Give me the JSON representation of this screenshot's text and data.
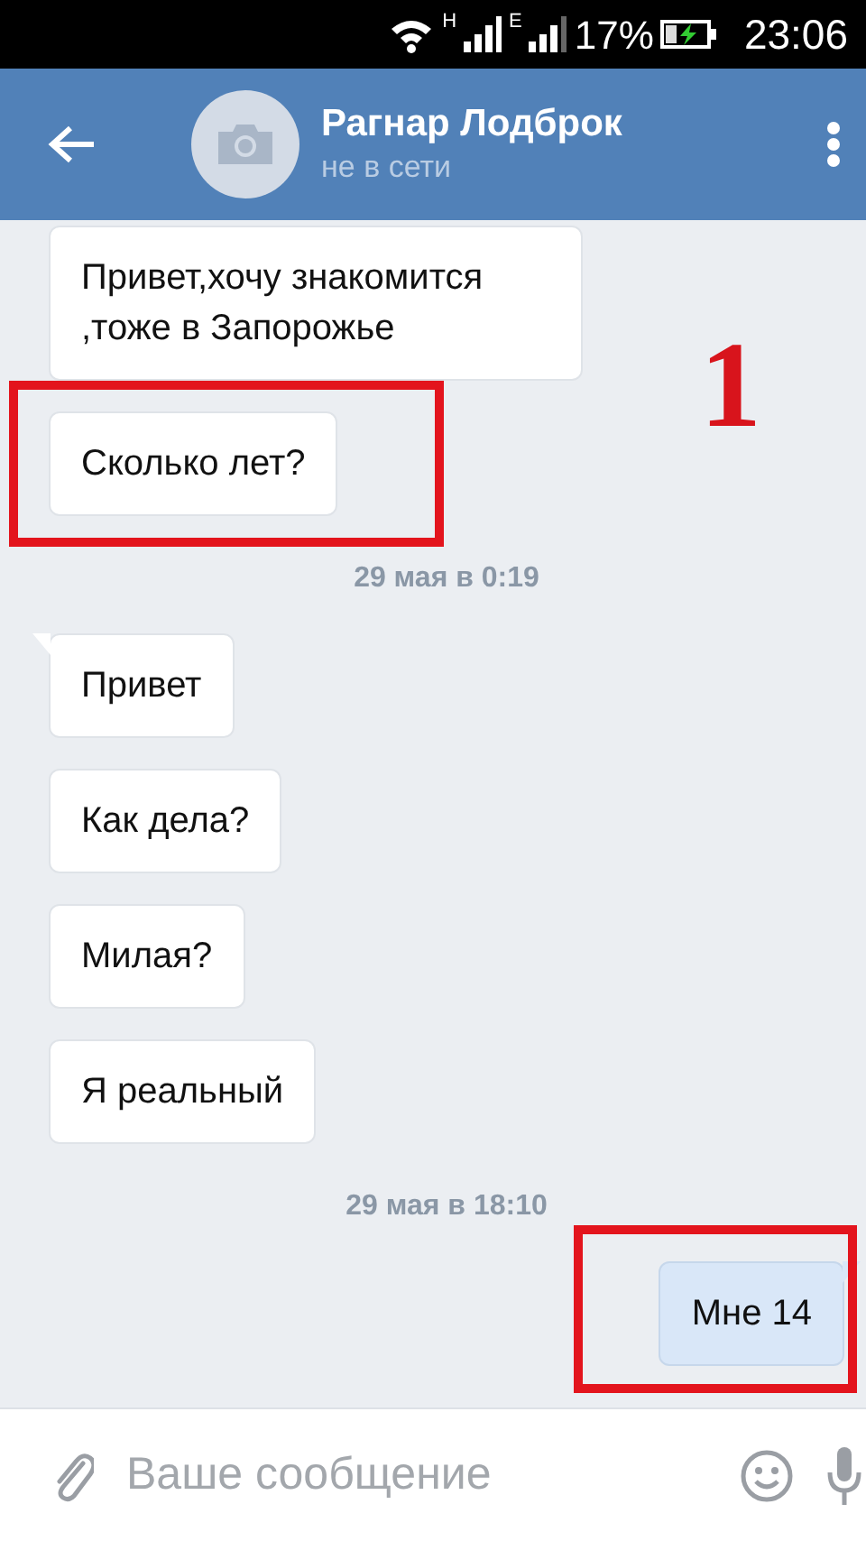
{
  "status_bar": {
    "network_1": "H",
    "network_2": "E",
    "battery": "17%",
    "battery_charging": true,
    "time": "23:06"
  },
  "header": {
    "name": "Рагнар Лодброк",
    "status": "не в сети"
  },
  "messages": [
    {
      "kind": "incoming",
      "text": "Привет,хочу знакомится ,тоже в Запорожье",
      "tail": false,
      "highlighted": false
    },
    {
      "kind": "incoming",
      "text": "Сколько лет?",
      "tail": false,
      "highlighted": true
    },
    {
      "kind": "date",
      "text": "29 мая в 0:19"
    },
    {
      "kind": "incoming",
      "text": "Привет",
      "tail": true,
      "highlighted": false
    },
    {
      "kind": "incoming",
      "text": "Как дела?",
      "tail": false,
      "highlighted": false
    },
    {
      "kind": "incoming",
      "text": "Милая?",
      "tail": false,
      "highlighted": false
    },
    {
      "kind": "incoming",
      "text": "Я реальный",
      "tail": false,
      "highlighted": false
    },
    {
      "kind": "date",
      "text": "29 мая в 18:10"
    },
    {
      "kind": "outgoing",
      "text": "Мне 14",
      "tail": true,
      "highlighted": true
    }
  ],
  "annotation": "1",
  "composer": {
    "placeholder": "Ваше сообщение"
  }
}
